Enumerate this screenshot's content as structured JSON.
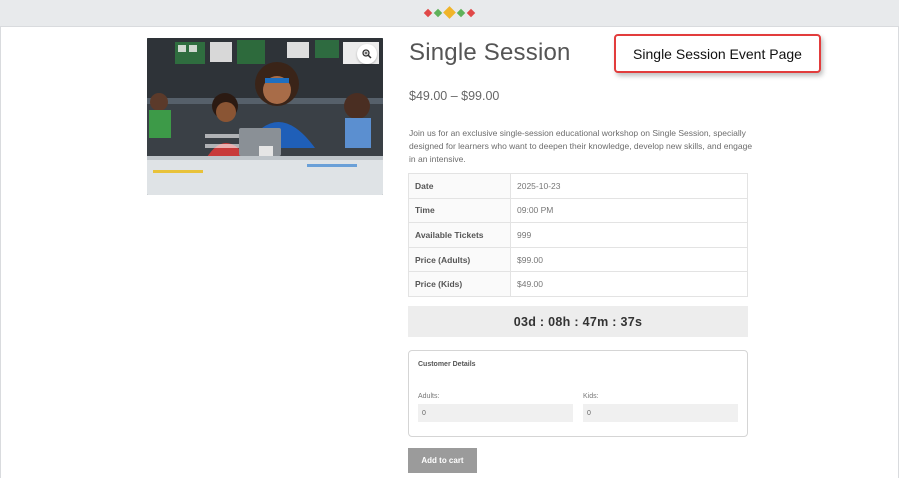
{
  "header": {
    "logo_icon": "diamond-dots-logo",
    "logo_colors": [
      "#e04848",
      "#5fb15a",
      "#f0b429",
      "#5fb15a",
      "#e04848"
    ]
  },
  "product": {
    "title": "Single Session",
    "price_range": "$49.00 – $99.00",
    "description": "Join us for an exclusive single-session educational workshop on Single Session, specially designed for learners who want to deepen their knowledge, develop new skills, and engage in an intensive.",
    "image_icon": "classroom-photo",
    "zoom_icon": "zoom-in-icon"
  },
  "callout": {
    "label": "Single Session Event Page",
    "border_color": "#e23c3c"
  },
  "details": [
    {
      "label": "Date",
      "value": "2025-10-23"
    },
    {
      "label": "Time",
      "value": "09:00 PM"
    },
    {
      "label": "Available Tickets",
      "value": "999"
    },
    {
      "label": "Price (Adults)",
      "value": "$99.00"
    },
    {
      "label": "Price (Kids)",
      "value": "$49.00"
    }
  ],
  "countdown": "03d : 08h : 47m : 37s",
  "customer": {
    "title": "Customer Details",
    "adults_label": "Adults:",
    "adults_value": "0",
    "kids_label": "Kids:",
    "kids_value": "0"
  },
  "cart": {
    "button_label": "Add to cart",
    "button_color": "#9b9b9b"
  }
}
